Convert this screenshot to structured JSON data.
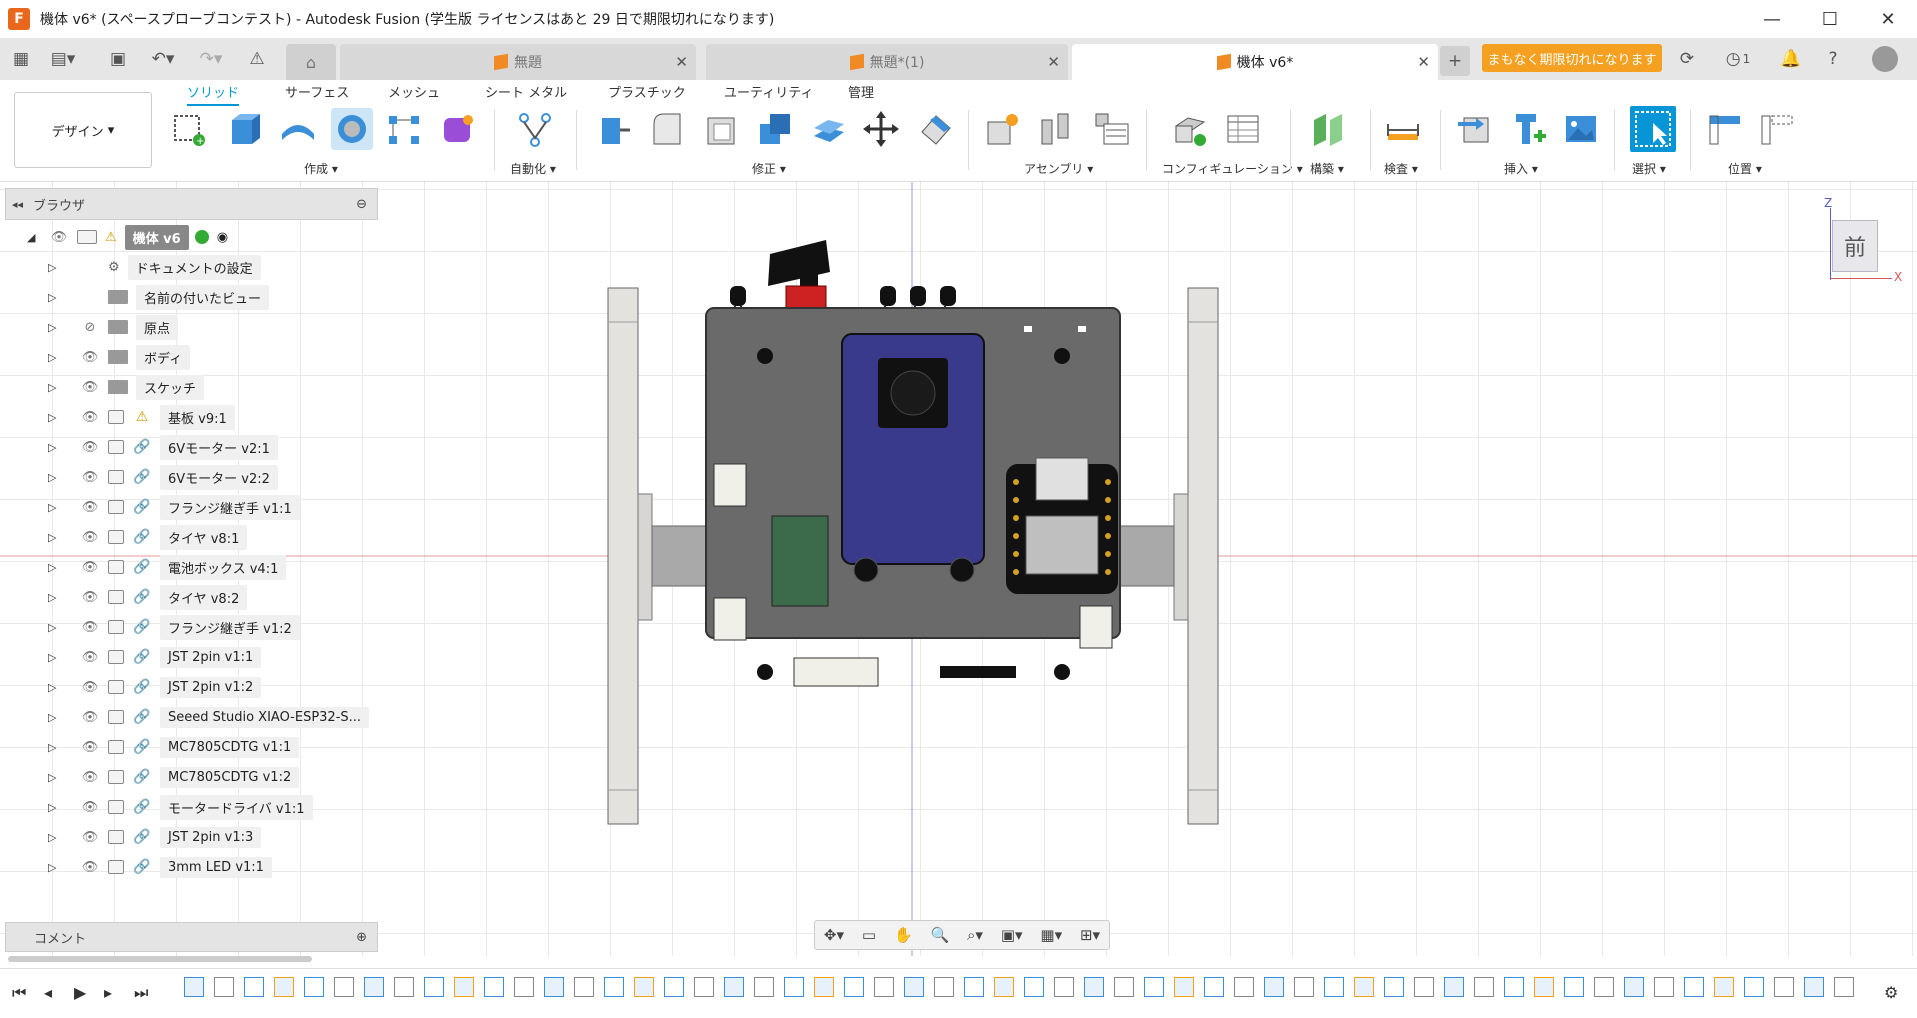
{
  "titlebar": {
    "app_letter": "F",
    "title": "機体 v6* (スペースプローブコンテスト) - Autodesk Fusion (学生版 ライセンスはあと 29 日で期限切れになります)"
  },
  "tabs": {
    "docs": [
      {
        "label": "無題",
        "active": false
      },
      {
        "label": "無題*(1)",
        "active": false
      },
      {
        "label": "機体 v6*",
        "active": true
      }
    ],
    "expire_label": "まもなく期限切れになります",
    "job_count": "1"
  },
  "ribbon": {
    "workspace": "デザイン",
    "tabs": [
      "ソリッド",
      "サーフェス",
      "メッシュ",
      "シート メタル",
      "プラスチック",
      "ユーティリティ",
      "管理"
    ],
    "groups": [
      "作成",
      "自動化",
      "修正",
      "アセンブリ",
      "コンフィギュレーション",
      "構築",
      "検査",
      "挿入",
      "選択",
      "位置"
    ]
  },
  "browser": {
    "title": "ブラウザ",
    "root": "機体 v6",
    "items": [
      {
        "label": "ドキュメントの設定",
        "kind": "settings"
      },
      {
        "label": "名前の付いたビュー",
        "kind": "folder"
      },
      {
        "label": "原点",
        "kind": "folder",
        "hidden": true
      },
      {
        "label": "ボディ",
        "kind": "folder"
      },
      {
        "label": "スケッチ",
        "kind": "folder"
      },
      {
        "label": "基板 v9:1",
        "kind": "comp-warn"
      },
      {
        "label": "6Vモーター v2:1",
        "kind": "comp"
      },
      {
        "label": "6Vモーター v2:2",
        "kind": "comp"
      },
      {
        "label": "フランジ継ぎ手 v1:1",
        "kind": "comp"
      },
      {
        "label": "タイヤ v8:1",
        "kind": "comp"
      },
      {
        "label": "電池ボックス v4:1",
        "kind": "comp"
      },
      {
        "label": "タイヤ v8:2",
        "kind": "comp"
      },
      {
        "label": "フランジ継ぎ手 v1:2",
        "kind": "comp"
      },
      {
        "label": "JST 2pin v1:1",
        "kind": "comp"
      },
      {
        "label": "JST 2pin v1:2",
        "kind": "comp"
      },
      {
        "label": "Seeed Studio XIAO-ESP32-S...",
        "kind": "comp"
      },
      {
        "label": "MC7805CDTG v1:1",
        "kind": "comp"
      },
      {
        "label": "MC7805CDTG v1:2",
        "kind": "comp"
      },
      {
        "label": "モータードライバ v1:1",
        "kind": "comp"
      },
      {
        "label": "JST 2pin v1:3",
        "kind": "comp"
      },
      {
        "label": "3mm LED v1:1",
        "kind": "comp"
      }
    ]
  },
  "comment_bar": {
    "title": "コメント"
  },
  "viewcube": {
    "face": "前",
    "axis_z": "Z",
    "axis_x": "X"
  },
  "colors": {
    "accent": "#0696d7",
    "warning": "#f5a020",
    "board": "#6a6a6a",
    "battery": "#3a3a8c",
    "motor_driver": "#3b6b4a"
  }
}
